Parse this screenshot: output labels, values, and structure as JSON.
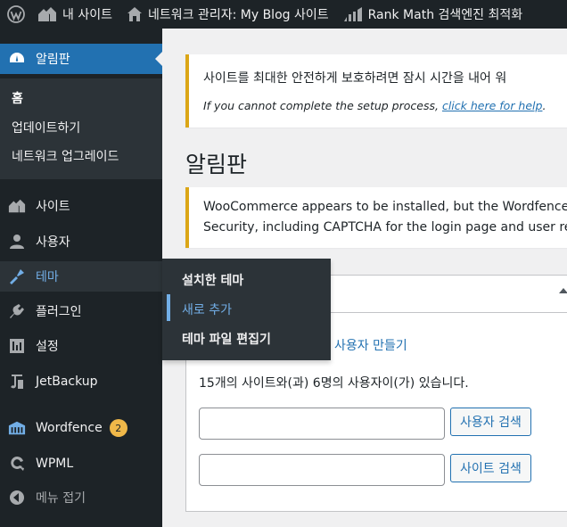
{
  "adminbar": {
    "my_sites": "내 사이트",
    "network_admin": "네트워크 관리자: My Blog 사이트",
    "rank_math": "Rank Math 검색엔진 최적화"
  },
  "sidebar": {
    "dashboard": "알림판",
    "sub": {
      "home": "홈",
      "updates": "업데이트하기",
      "network_upgrade": "네트워크 업그레이드"
    },
    "items": {
      "sites": "사이트",
      "users": "사용자",
      "themes": "테마",
      "plugins": "플러그인",
      "settings": "설정",
      "jetbackup": "JetBackup",
      "wordfence": "Wordfence",
      "wordfence_badge": "2",
      "wpml": "WPML",
      "collapse": "메뉴 접기"
    }
  },
  "flyout": {
    "installed_themes": "설치한 테마",
    "add_new": "새로 추가",
    "theme_file_editor": "테마 파일 편집기"
  },
  "content": {
    "notice1": {
      "text": "사이트를 최대한 안전하게 보호하려면 잠시 시간을 내어 워",
      "help_prefix": "If you cannot complete the setup process, ",
      "help_link": "click here for help",
      "help_suffix": "."
    },
    "page_title": "알림판",
    "notice2": {
      "line1": "WooCommerce appears to be installed, but the Wordfence Log",
      "line2": "Security, including CAPTCHA for the login page and user regist"
    },
    "box": {
      "create_user_link": "사용자 만들기",
      "stats": "15개의 사이트와(과) 6명의 사용자이(가) 있습니다.",
      "search_users_button": "사용자 검색",
      "search_sites_button": "사이트 검색"
    }
  },
  "colors": {
    "admin_bg": "#1d2327",
    "accent": "#2271b1",
    "highlight": "#72aee6",
    "warning": "#dba617",
    "badge": "#f0b849"
  }
}
